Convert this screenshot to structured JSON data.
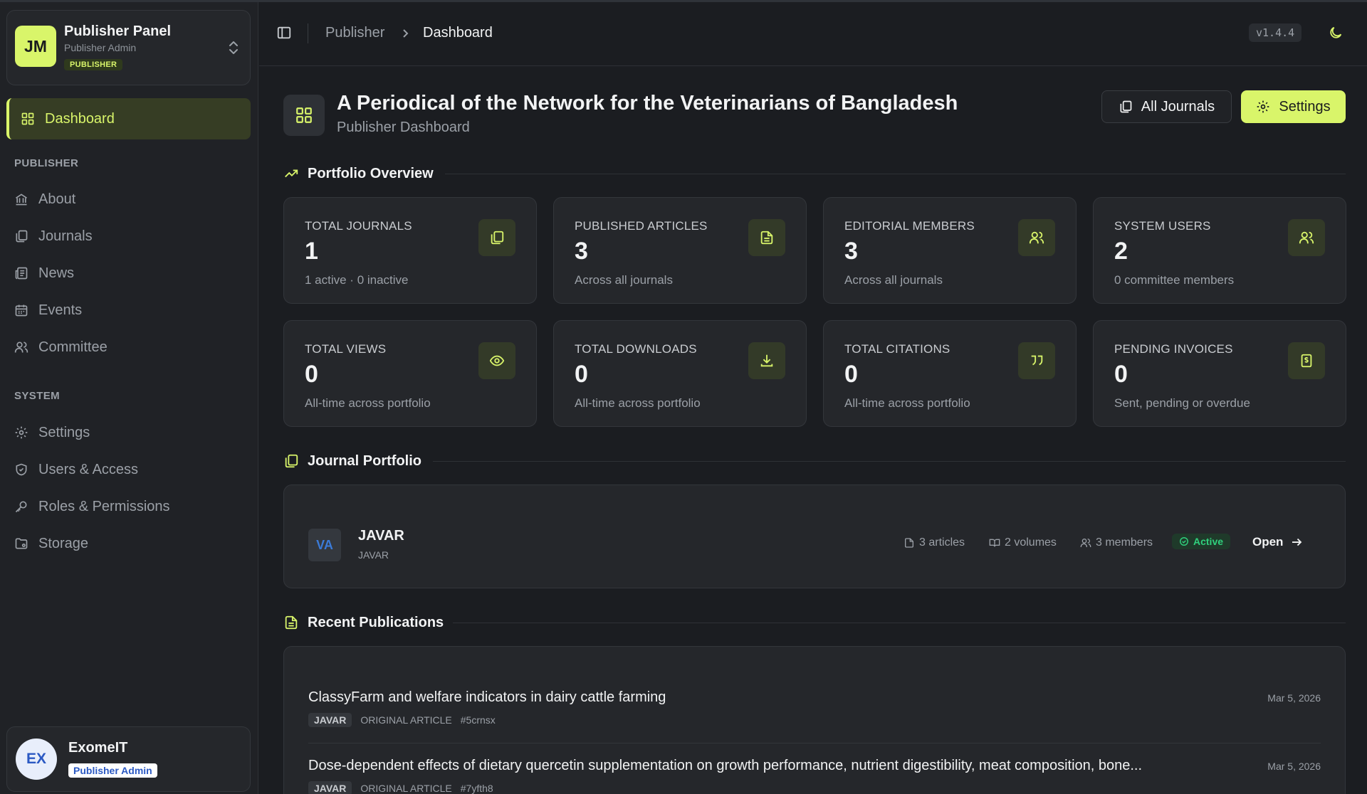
{
  "colors": {
    "accent": "#d9f56a",
    "background": "#1b1d21",
    "card": "#25272b",
    "active_status": "#30d17d"
  },
  "brand": {
    "initials": "JM",
    "title": "Publisher Panel",
    "subtitle": "Publisher Admin",
    "badge": "PUBLISHER"
  },
  "sidebar": {
    "active": {
      "label": "Dashboard",
      "icon": "dashboard-grid-icon"
    },
    "sections": [
      {
        "title": "PUBLISHER",
        "items": [
          {
            "label": "About",
            "icon": "bank-icon"
          },
          {
            "label": "Journals",
            "icon": "journals-icon"
          },
          {
            "label": "News",
            "icon": "newspaper-icon"
          },
          {
            "label": "Events",
            "icon": "calendar-icon"
          },
          {
            "label": "Committee",
            "icon": "users-icon"
          }
        ]
      },
      {
        "title": "SYSTEM",
        "items": [
          {
            "label": "Settings",
            "icon": "gear-icon"
          },
          {
            "label": "Users & Access",
            "icon": "shield-icon"
          },
          {
            "label": "Roles & Permissions",
            "icon": "key-icon"
          },
          {
            "label": "Storage",
            "icon": "folder-icon"
          }
        ]
      }
    ]
  },
  "user": {
    "initials": "EX",
    "name": "ExomeIT",
    "role": "Publisher Admin"
  },
  "header": {
    "breadcrumb": [
      "Publisher",
      "Dashboard"
    ],
    "version": "v1.4.4"
  },
  "page": {
    "title": "A Periodical of the Network for the Veterinarians of Bangladesh",
    "subtitle": "Publisher Dashboard",
    "all_journals_label": "All Journals",
    "settings_label": "Settings"
  },
  "overview": {
    "title": "Portfolio Overview",
    "stats": [
      {
        "label": "TOTAL JOURNALS",
        "value": "1",
        "sub": "1 active · 0 inactive",
        "icon": "journals-icon"
      },
      {
        "label": "PUBLISHED ARTICLES",
        "value": "3",
        "sub": "Across all journals",
        "icon": "document-icon"
      },
      {
        "label": "EDITORIAL MEMBERS",
        "value": "3",
        "sub": "Across all journals",
        "icon": "users-icon"
      },
      {
        "label": "SYSTEM USERS",
        "value": "2",
        "sub": "0 committee members",
        "icon": "users-icon"
      },
      {
        "label": "TOTAL VIEWS",
        "value": "0",
        "sub": "All-time across portfolio",
        "icon": "eye-icon"
      },
      {
        "label": "TOTAL DOWNLOADS",
        "value": "0",
        "sub": "All-time across portfolio",
        "icon": "download-icon"
      },
      {
        "label": "TOTAL CITATIONS",
        "value": "0",
        "sub": "All-time across portfolio",
        "icon": "quote-icon"
      },
      {
        "label": "PENDING INVOICES",
        "value": "0",
        "sub": "Sent, pending or overdue",
        "icon": "invoice-icon"
      }
    ]
  },
  "portfolio": {
    "title": "Journal Portfolio",
    "journal": {
      "logo_text": "VA",
      "name": "JAVAR",
      "abbr": "JAVAR",
      "articles": "3 articles",
      "volumes": "2 volumes",
      "members": "3 members",
      "status": "Active",
      "open_label": "Open"
    }
  },
  "recent": {
    "title": "Recent Publications",
    "items": [
      {
        "title": "ClassyFarm and welfare indicators in dairy cattle farming",
        "date": "Mar 5, 2026",
        "journal": "JAVAR",
        "type": "ORIGINAL ARTICLE",
        "id": "#5crnsx"
      },
      {
        "title": "Dose-dependent effects of dietary quercetin supplementation on growth performance, nutrient digestibility, meat composition, bone...",
        "date": "Mar 5, 2026",
        "journal": "JAVAR",
        "type": "ORIGINAL ARTICLE",
        "id": "#7yfth8"
      }
    ]
  }
}
